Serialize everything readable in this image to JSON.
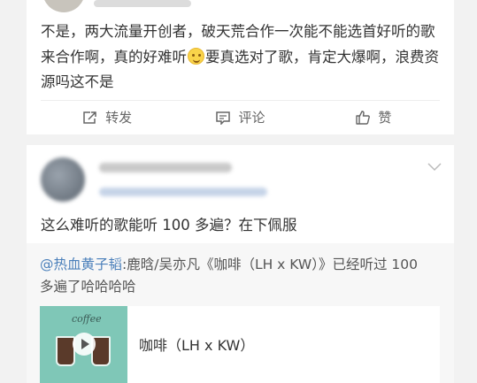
{
  "post1": {
    "text_a": "不是，两大流量开创者，破天荒合作一次能不能选首好听的歌来合作啊，真的好难听",
    "text_b": "要真选对了歌，肯定大爆啊，浪费资源吗这不是",
    "emoji": "sweat-smile-emoji",
    "actions": {
      "repost": "转发",
      "comment": "评论",
      "like": "赞"
    }
  },
  "post2": {
    "text": "这么难听的歌能听 100 多遍？在下佩服",
    "quote": {
      "mention": "@热血黄子韬",
      "body": ":鹿晗/吴亦凡《咖啡（LH x KW）》已经听过 100 多遍了哈哈哈哈"
    },
    "media": {
      "thumb_text": "coffee",
      "title": "咖啡（LH x KW）"
    }
  },
  "colors": {
    "link": "#4a7fba",
    "background": "#f2f2f2",
    "card": "#ffffff"
  }
}
